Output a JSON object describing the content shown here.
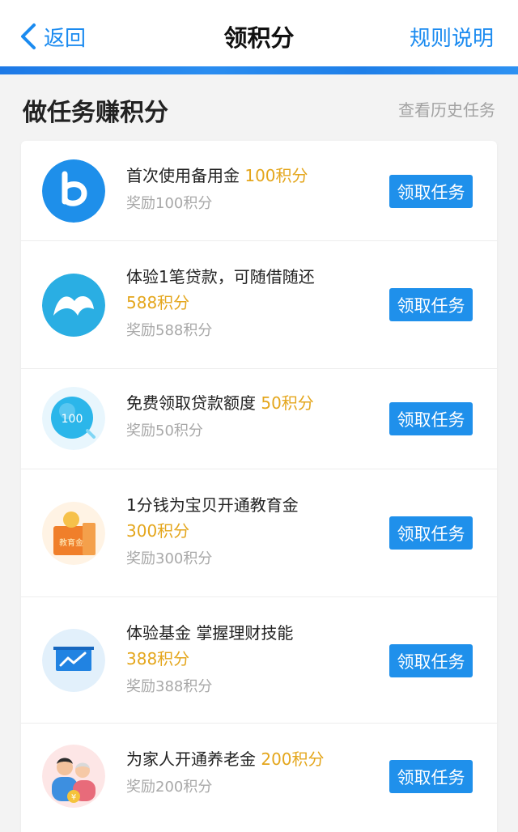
{
  "header": {
    "back_label": "返回",
    "title": "领积分",
    "rules_label": "规则说明"
  },
  "section": {
    "title": "做任务赚积分",
    "history_label": "查看历史任务"
  },
  "tasks": [
    {
      "icon": "letter-b-icon",
      "title": "首次使用备用金",
      "points": "100积分",
      "reward": "奖励100积分",
      "button": "领取任务"
    },
    {
      "icon": "cloud-loan-icon",
      "title": "体验1笔贷款，可随借随还",
      "points": "588积分",
      "reward": "奖励588积分",
      "button": "领取任务"
    },
    {
      "icon": "credit-bubble-icon",
      "icon_text": "100",
      "title": "免费领取贷款额度",
      "points": "50积分",
      "reward": "奖励50积分",
      "button": "领取任务"
    },
    {
      "icon": "education-fund-icon",
      "icon_text": "教育金",
      "title": "1分钱为宝贝开通教育金",
      "points": "300积分",
      "reward": "奖励300积分",
      "button": "领取任务"
    },
    {
      "icon": "trend-chart-icon",
      "title": "体验基金 掌握理财技能",
      "points": "388积分",
      "reward": "奖励388积分",
      "button": "领取任务"
    },
    {
      "icon": "family-avatar-icon",
      "icon_text": "¥",
      "title": "为家人开通养老金",
      "points": "200积分",
      "reward": "奖励200积分",
      "button": "领取任务"
    }
  ],
  "colors": {
    "accent": "#1f90eb",
    "link": "#1b8bf0",
    "points": "#e4a61c",
    "muted": "#a8a8a8"
  }
}
